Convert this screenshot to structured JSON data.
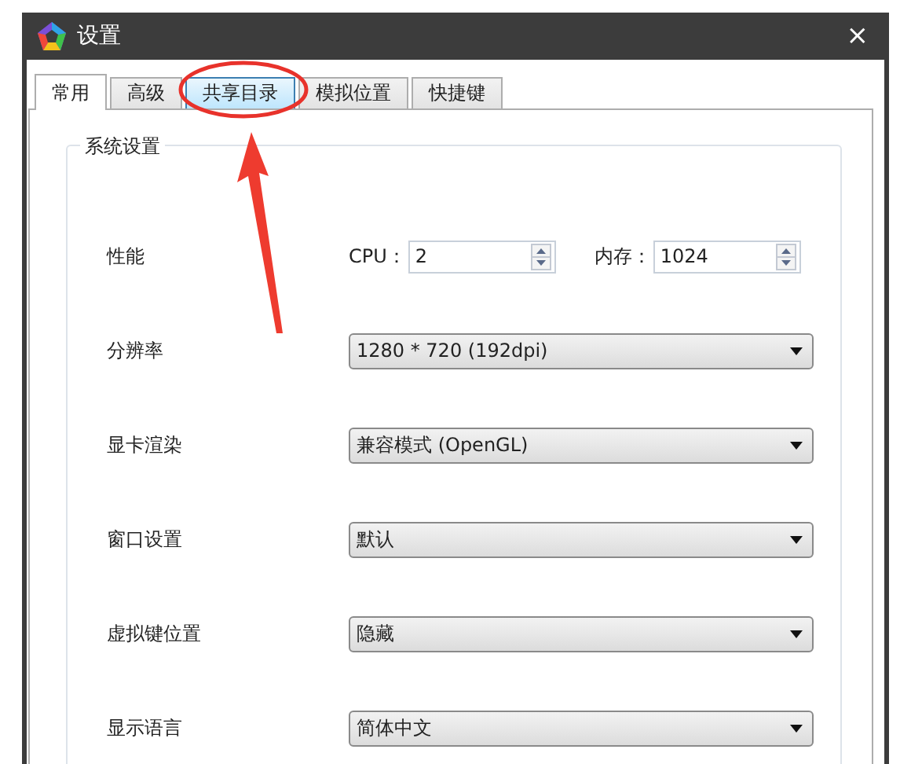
{
  "window": {
    "title": "设置",
    "close": "×"
  },
  "tabs": [
    {
      "label": "常用",
      "selected": true,
      "hovered": false
    },
    {
      "label": "高级",
      "selected": false,
      "hovered": false
    },
    {
      "label": "共享目录",
      "selected": false,
      "hovered": true
    },
    {
      "label": "模拟位置",
      "selected": false,
      "hovered": false
    },
    {
      "label": "快捷键",
      "selected": false,
      "hovered": false
    }
  ],
  "group": {
    "title": "系统设置",
    "rows": [
      {
        "kind": "spinners",
        "label": "性能",
        "fields": [
          {
            "label": "CPU：",
            "value": "2"
          },
          {
            "label": "内存：",
            "value": "1024"
          }
        ]
      },
      {
        "kind": "dropdown",
        "label": "分辨率",
        "value": "1280 * 720 (192dpi)"
      },
      {
        "kind": "dropdown",
        "label": "显卡渲染",
        "value": "兼容模式 (OpenGL)"
      },
      {
        "kind": "dropdown",
        "label": "窗口设置",
        "value": "默认"
      },
      {
        "kind": "dropdown",
        "label": "虚拟键位置",
        "value": "隐藏"
      },
      {
        "kind": "dropdown",
        "label": "显示语言",
        "value": "简体中文"
      }
    ]
  }
}
